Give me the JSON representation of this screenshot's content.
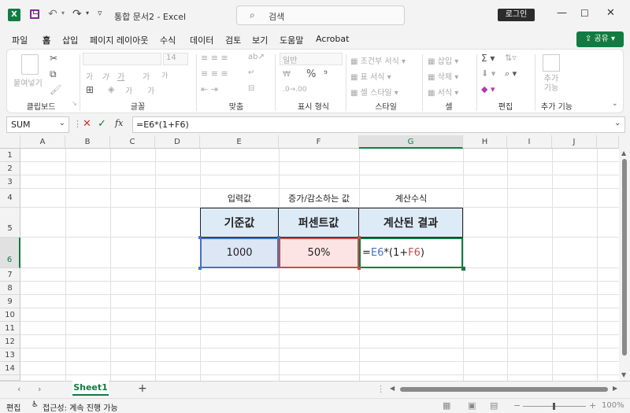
{
  "title_bar": {
    "app_icon": "excel-icon",
    "doc_title": "통합 문서2 - Excel",
    "search_label": "검색",
    "login_label": "로그인",
    "window_controls": [
      "minimize-icon",
      "maximize-icon",
      "close-icon"
    ]
  },
  "tabs": [
    {
      "label": "파일"
    },
    {
      "label": "홈",
      "active": true
    },
    {
      "label": "삽입"
    },
    {
      "label": "페이지 레이아웃"
    },
    {
      "label": "수식"
    },
    {
      "label": "데이터"
    },
    {
      "label": "검토"
    },
    {
      "label": "보기"
    },
    {
      "label": "도움말"
    },
    {
      "label": "Acrobat"
    }
  ],
  "share_label": "공유",
  "ribbon": {
    "clipboard": {
      "paste_label": "붙여넣기",
      "group_label": "클립보드"
    },
    "font": {
      "font_name": "",
      "font_size": "14",
      "group_label": "글꼴",
      "bold": "가",
      "italic": "가",
      "underline": "가",
      "grow": "가",
      "shrink": "가",
      "phonetic": "가",
      "color_a": "가"
    },
    "alignment": {
      "group_label": "맞춤"
    },
    "number": {
      "format": "일반",
      "group_label": "표시 형식"
    },
    "styles": {
      "items": [
        "조건부 서식",
        "표 서식",
        "셀 스타일"
      ],
      "group_label": "스타일"
    },
    "cells": {
      "items": [
        "삽입",
        "삭제",
        "서식"
      ],
      "group_label": "셀"
    },
    "editing": {
      "group_label": "편집"
    },
    "addins": {
      "label": "추가 기능",
      "group_label": "추가 기능"
    }
  },
  "formula_bar": {
    "name_box": "SUM",
    "formula": "=E6*(1+F6)"
  },
  "columns": [
    "A",
    "B",
    "C",
    "D",
    "E",
    "F",
    "G",
    "H",
    "I",
    "J"
  ],
  "rows": [
    "1",
    "2",
    "3",
    "4",
    "5",
    "6",
    "7",
    "8",
    "9",
    "10",
    "11",
    "12",
    "13",
    "14"
  ],
  "cells": {
    "E4": "입력값",
    "F4": "증가/감소하는 값",
    "G4": "계산수식",
    "E5": "기준값",
    "F5": "퍼센트값",
    "G5": "계산된 결과",
    "E6": "1000",
    "F6": "50%",
    "G6_parts": [
      "=",
      "E6",
      "*(1+",
      "F6",
      ")"
    ]
  },
  "colors": {
    "accent": "#107c41",
    "header_fill": "#ddebf7",
    "ref_blue": "#4472c4",
    "ref_red": "#c0504d",
    "e6_fill": "#dde6f5",
    "f6_fill": "#fce4e4"
  },
  "sheet_tabs": [
    {
      "label": "Sheet1",
      "active": true
    }
  ],
  "status": {
    "mode": "편집",
    "accessibility": "접근성: 계속 진행 가능",
    "zoom": "100%"
  }
}
